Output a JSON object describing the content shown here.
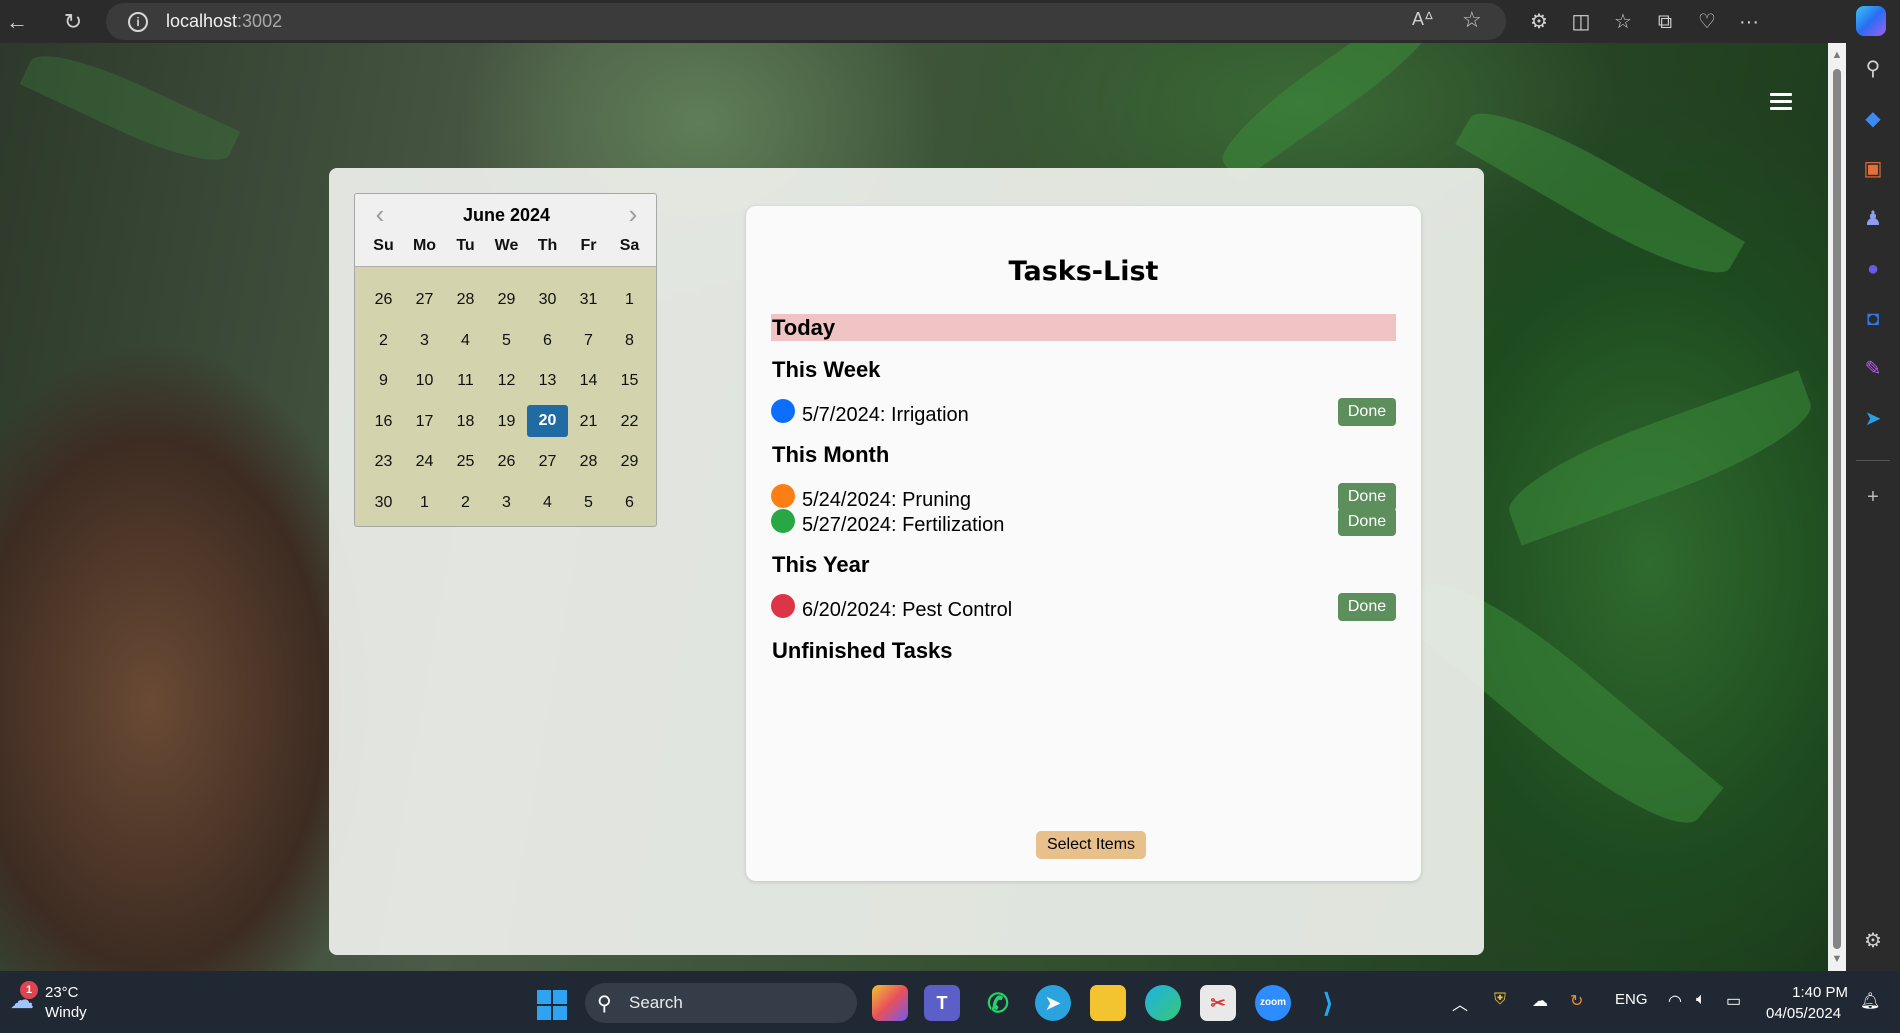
{
  "browser": {
    "url_host": "localhost",
    "url_port": ":3002"
  },
  "calendar": {
    "month_label": "June 2024",
    "weekdays": [
      "Su",
      "Mo",
      "Tu",
      "We",
      "Th",
      "Fr",
      "Sa"
    ],
    "weeks": [
      [
        "26",
        "27",
        "28",
        "29",
        "30",
        "31",
        "1"
      ],
      [
        "2",
        "3",
        "4",
        "5",
        "6",
        "7",
        "8"
      ],
      [
        "9",
        "10",
        "11",
        "12",
        "13",
        "14",
        "15"
      ],
      [
        "16",
        "17",
        "18",
        "19",
        "20",
        "21",
        "22"
      ],
      [
        "23",
        "24",
        "25",
        "26",
        "27",
        "28",
        "29"
      ],
      [
        "30",
        "1",
        "2",
        "3",
        "4",
        "5",
        "6"
      ]
    ],
    "selected_day": "20"
  },
  "tasks": {
    "title": "Tasks-List",
    "sections": {
      "today": "Today",
      "this_week": "This Week",
      "this_month": "This Month",
      "this_year": "This Year",
      "unfinished": "Unfinished Tasks"
    },
    "items": [
      {
        "text": "5/7/2024: Irrigation",
        "dot_color": "#0d6efd",
        "button": "Done"
      },
      {
        "text": "5/24/2024: Pruning",
        "dot_color": "#fd7e14",
        "button": "Done"
      },
      {
        "text": "5/27/2024: Fertilization",
        "dot_color": "#28a745",
        "button": "Done"
      },
      {
        "text": "6/20/2024: Pest Control",
        "dot_color": "#dc3545",
        "button": "Done"
      }
    ],
    "select_items_label": "Select Items"
  },
  "taskbar": {
    "weather_temp": "23°C",
    "weather_condition": "Windy",
    "weather_badge": "1",
    "search_label": "Search",
    "language": "ENG",
    "time": "1:40 PM",
    "date": "04/05/2024"
  }
}
